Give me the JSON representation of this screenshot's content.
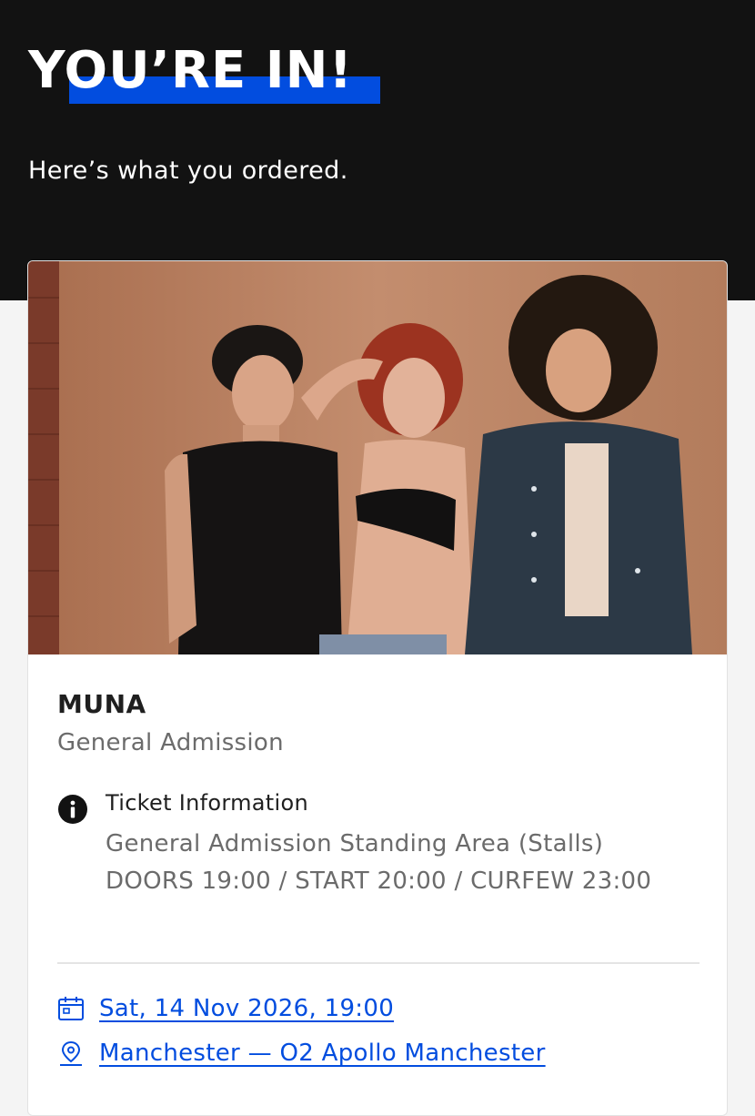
{
  "header": {
    "title": "YOU’RE IN!",
    "subtitle": "Here’s what you ordered.",
    "accent_color": "#024ddf",
    "background_color": "#121212"
  },
  "order": {
    "event_name": "MUNA",
    "ticket_type": "General Admission",
    "info_icon": "info-icon",
    "info_title": "Ticket Information",
    "info_line_1": "General Admission Standing Area (Stalls)",
    "info_line_2": "DOORS 19:00 / START 20:00 / CURFEW 23:00",
    "date_icon": "calendar-icon",
    "date": "Sat, 14 Nov 2026, 19:00",
    "venue_icon": "map-pin-icon",
    "venue": "Manchester — O2 Apollo Manchester",
    "link_color": "#024ddf"
  }
}
